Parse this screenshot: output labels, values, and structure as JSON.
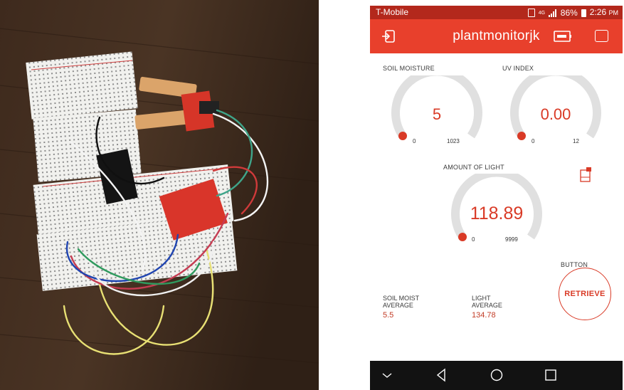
{
  "status_bar": {
    "carrier": "T-Mobile",
    "network": "4G",
    "battery": "86%",
    "time": "2:26",
    "ampm": "PM"
  },
  "app_bar": {
    "title": "plantmonitorjk"
  },
  "gauges": {
    "soil": {
      "label": "SOIL MOISTURE",
      "value": "5",
      "min": "0",
      "max": "1023",
      "fraction": 0.005
    },
    "uv": {
      "label": "UV INDEX",
      "value": "0.00",
      "min": "0",
      "max": "12",
      "fraction": 0.0
    },
    "light": {
      "label": "AMOUNT OF LIGHT",
      "value": "118.89",
      "min": "0",
      "max": "9999",
      "fraction": 0.012
    }
  },
  "button": {
    "label": "BUTTON",
    "text": "RETRIEVE"
  },
  "averages": {
    "soil": {
      "label_line1": "SOIL MOIST",
      "label_line2": "AVERAGE",
      "value": "5.5"
    },
    "light": {
      "label_line1": "LIGHT",
      "label_line2": "AVERAGE",
      "value": "134.78"
    }
  },
  "colors": {
    "status_bar": "#b3281c",
    "app_bar": "#e8402c",
    "accent": "#d93a26",
    "gauge_track": "#e0e0e0"
  },
  "icons": [
    "back-icon",
    "device-icon",
    "square-icon",
    "notification-icon",
    "nav-down-icon",
    "nav-back-icon",
    "nav-home-icon",
    "nav-recent-icon"
  ]
}
